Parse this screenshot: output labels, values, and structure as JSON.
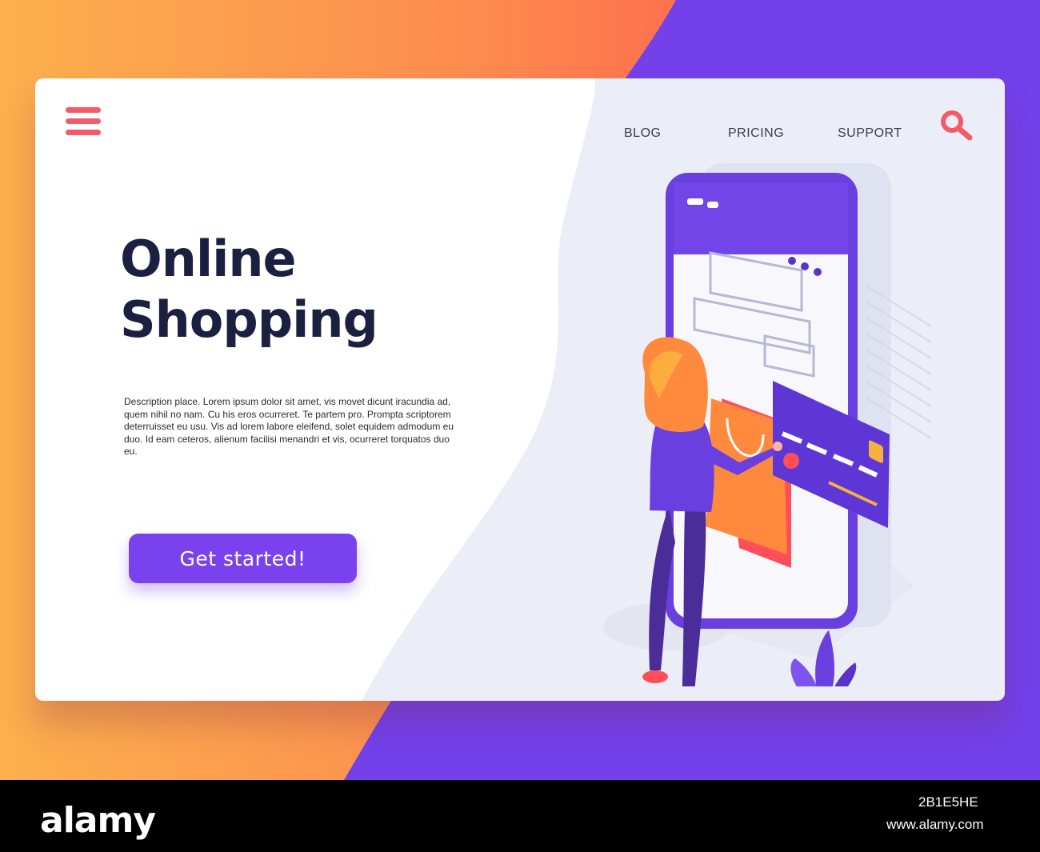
{
  "nav": {
    "items": [
      "BLOG",
      "PRICING",
      "SUPPORT"
    ]
  },
  "hero": {
    "title_line1": "Online",
    "title_line2": "Shopping",
    "description": "Description place.  Lorem ipsum dolor sit amet, vis movet dicunt iracundia ad, quem nihil no nam. Cu his eros ocurreret. Te partem pro. Prompta scriptorem deterruisset eu usu. Vis ad lorem labore eleifend, solet equidem admodum eu duo. Id eam ceteros, alienum facilisi menandri et vis, ocurreret torquatos duo eu.",
    "cta_label": "Get started!"
  },
  "footer": {
    "logo": "alamy",
    "image_code": "2B1E5HE",
    "url": "www.alamy.com"
  },
  "colors": {
    "accent_purple": "#7a42ee",
    "accent_red": "#f35a6a",
    "orange": "#fd8c4f",
    "title_navy": "#1c2040"
  },
  "icons": [
    "hamburger-menu-icon",
    "search-icon"
  ]
}
